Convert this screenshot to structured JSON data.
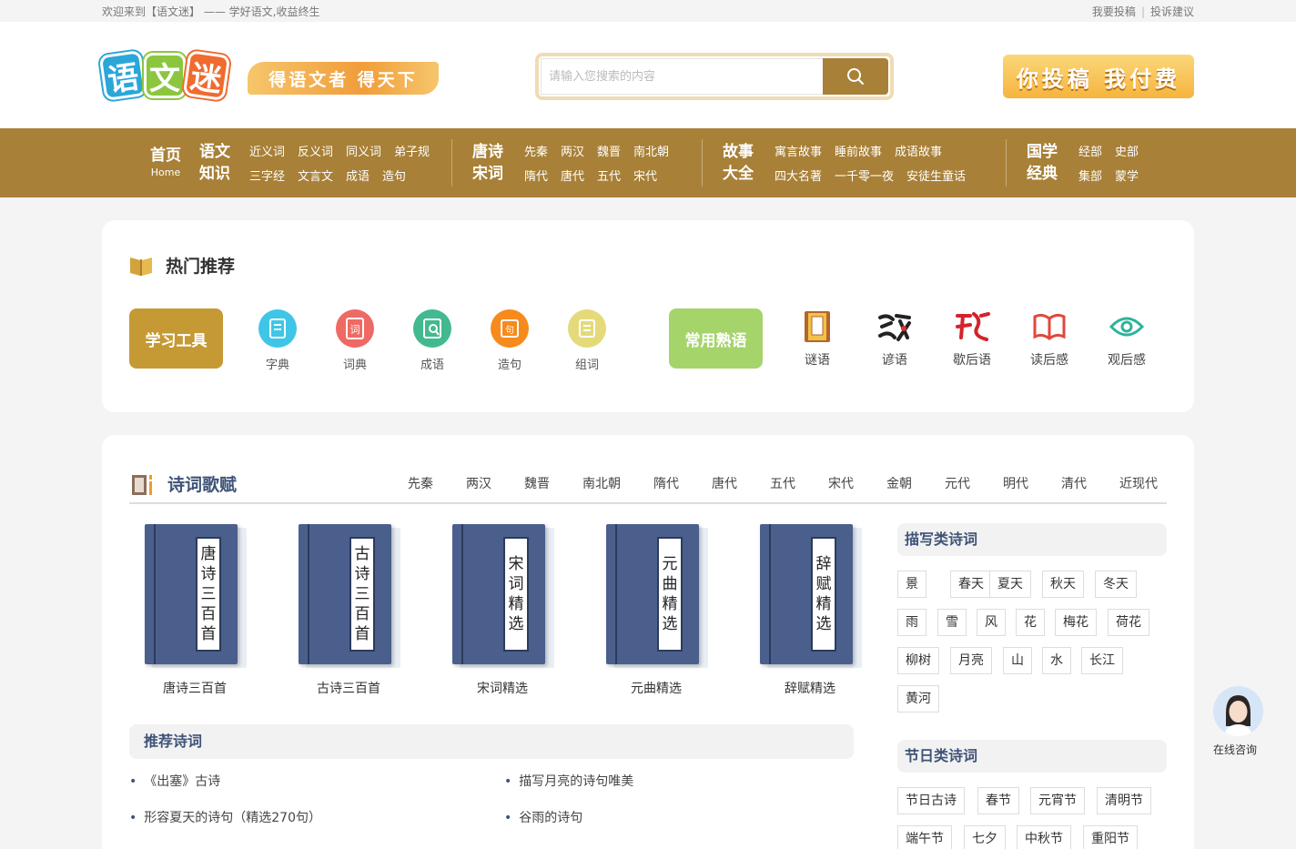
{
  "topbar": {
    "welcome": "欢迎来到【语文迷】 —— 学好语文,收益终生",
    "links": [
      "我要投稿",
      "投诉建议"
    ]
  },
  "header": {
    "logo_chars": [
      "语",
      "文",
      "迷"
    ],
    "slogan": "得语文者 得天下",
    "search_placeholder": "请输入您搜索的内容",
    "banner": "你投稿 我付费"
  },
  "nav": {
    "home": {
      "title": "首页",
      "sub": "Home"
    },
    "groups": [
      {
        "title": [
          "语文",
          "知识"
        ],
        "rows": [
          [
            "近义词",
            "反义词",
            "同义词",
            "弟子规"
          ],
          [
            "三字经",
            "文言文",
            "成语",
            "造句"
          ]
        ]
      },
      {
        "title": [
          "唐诗",
          "宋词"
        ],
        "rows": [
          [
            "先秦",
            "两汉",
            "魏晋",
            "南北朝"
          ],
          [
            "隋代",
            "唐代",
            "五代",
            "宋代"
          ]
        ]
      },
      {
        "title": [
          "故事",
          "大全"
        ],
        "rows": [
          [
            "寓言故事",
            "睡前故事",
            "成语故事"
          ],
          [
            "四大名著",
            "一千零一夜",
            "安徒生童话"
          ]
        ]
      },
      {
        "title": [
          "国学",
          "经典"
        ],
        "rows": [
          [
            "经部",
            "史部"
          ],
          [
            "集部",
            "蒙学"
          ]
        ]
      }
    ]
  },
  "hot": {
    "title": "热门推荐",
    "study_tools_label": "学习工具",
    "tools": [
      {
        "label": "字典",
        "color": "#3fc6e6",
        "glyph": "▤"
      },
      {
        "label": "词典",
        "color": "#ee6a64",
        "glyph": "词"
      },
      {
        "label": "成语",
        "color": "#43b98f",
        "glyph": "▧"
      },
      {
        "label": "造句",
        "color": "#f78a1c",
        "glyph": "句"
      },
      {
        "label": "组词",
        "color": "#e5da7a",
        "glyph": "▥"
      }
    ],
    "common_label": "常用熟语",
    "phrases": [
      {
        "label": "谜语",
        "icon": "riddle-book-icon"
      },
      {
        "label": "谚语",
        "icon": "proverb-calligraphy-icon"
      },
      {
        "label": "歇后语",
        "icon": "xiehouyu-calligraphy-icon"
      },
      {
        "label": "读后感",
        "icon": "open-book-icon"
      },
      {
        "label": "观后感",
        "icon": "eye-icon"
      }
    ]
  },
  "poem": {
    "title": "诗词歌赋",
    "eras": [
      "先秦",
      "两汉",
      "魏晋",
      "南北朝",
      "隋代",
      "唐代",
      "五代",
      "宋代",
      "金朝",
      "元代",
      "明代",
      "清代",
      "近现代"
    ],
    "books": [
      {
        "name": "唐诗三百首",
        "cover": [
          "唐",
          "诗",
          "三",
          "百",
          "首"
        ]
      },
      {
        "name": "古诗三百首",
        "cover": [
          "古",
          "诗",
          "三",
          "百",
          "首"
        ]
      },
      {
        "name": "宋词精选",
        "cover": [
          "宋",
          "词",
          "精",
          "选"
        ]
      },
      {
        "name": "元曲精选",
        "cover": [
          "元",
          "曲",
          "精",
          "选"
        ]
      },
      {
        "name": "辞赋精选",
        "cover": [
          "辞",
          "赋",
          "精",
          "选"
        ]
      }
    ],
    "recommend_title": "推荐诗词",
    "recommend": [
      "《出塞》古诗",
      "描写月亮的诗句唯美",
      "形容夏天的诗句（精选270句）",
      "谷雨的诗句"
    ],
    "describe_title": "描写类诗词",
    "describe_tags": [
      "景",
      "春天",
      "夏天",
      "秋天",
      "冬天",
      "雨",
      "雪",
      "风",
      "花",
      "梅花",
      "荷花",
      "柳树",
      "月亮",
      "山",
      "水",
      "长江",
      "黄河"
    ],
    "festival_title": "节日类诗词",
    "festival_tags": [
      "节日古诗",
      "春节",
      "元宵节",
      "清明节",
      "端午节",
      "七夕",
      "中秋节",
      "重阳节"
    ]
  },
  "chat": {
    "label": "在线咨询"
  }
}
